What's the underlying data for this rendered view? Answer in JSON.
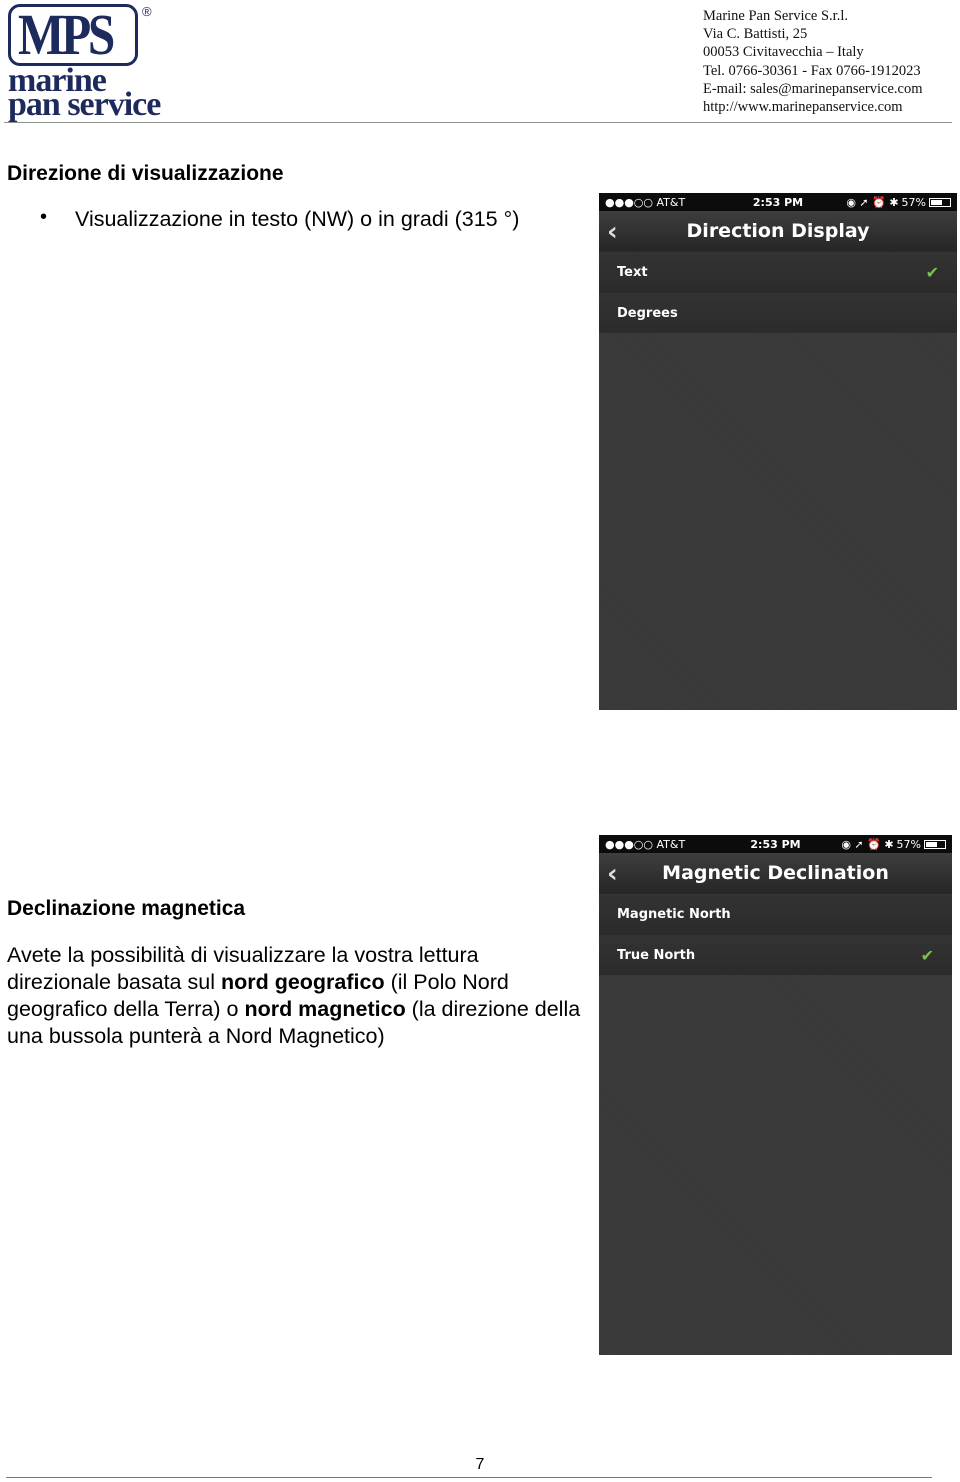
{
  "header": {
    "logo_text": {
      "mps": "MPS",
      "line1": "marine",
      "line2": "pan service",
      "reg": "®"
    },
    "address": [
      "Marine Pan Service S.r.l.",
      "Via C. Battisti, 25",
      "00053 Civitavecchia – Italy",
      "Tel. 0766-30361 - Fax 0766-1912023",
      "E-mail: sales@marinepanservice.com",
      "http://www.marinepanservice.com"
    ]
  },
  "section1": {
    "heading": "Direzione di visualizzazione",
    "bullet": "Visualizzazione in testo (NW) o in gradi (315 °)",
    "phone": {
      "carrier": "●●●○○ AT&T",
      "time": "2:53 PM",
      "battery": "57%",
      "battery_level": 57,
      "title": "Direction Display",
      "options": [
        {
          "label": "Text",
          "selected": true
        },
        {
          "label": "Degrees",
          "selected": false
        }
      ]
    }
  },
  "section2": {
    "heading": "Declinazione magnetica",
    "para": {
      "t1": "Avete la possibilità di visualizzare la vostra lettura direzionale basata sul ",
      "b1": "nord geografico",
      "t2": " (il Polo Nord geografico della Terra) o ",
      "b2": "nord magnetico",
      "t3": " (la direzione della una bussola punterà a Nord Magnetico)"
    },
    "phone": {
      "carrier": "●●●○○ AT&T",
      "time": "2:53 PM",
      "battery": "57%",
      "battery_level": 57,
      "title": "Magnetic Declination",
      "options": [
        {
          "label": "Magnetic North",
          "selected": false
        },
        {
          "label": "True North",
          "selected": true
        }
      ]
    }
  },
  "colors": {
    "brand": "#1d2a5c",
    "check": "#7cc04a"
  },
  "footer": {
    "page_number": "7"
  }
}
